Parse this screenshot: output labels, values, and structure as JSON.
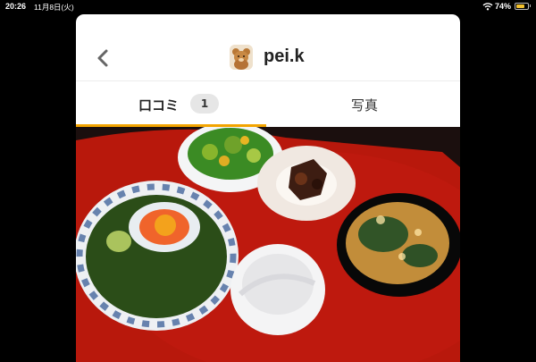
{
  "status_bar": {
    "time": "20:26",
    "date": "11月8日(火)",
    "battery": "74%",
    "battery_level": 0.74,
    "battery_color": "#f2c12e"
  },
  "header": {
    "back_icon": "chevron-left-icon",
    "avatar_icon": "teddy-bear-avatar",
    "username": "pei.k"
  },
  "tabs": [
    {
      "label": "口コミ",
      "count": "1",
      "active": true
    },
    {
      "label": "写真",
      "active": false
    }
  ],
  "colors": {
    "accent": "#f3a400",
    "tray": "#b8180c"
  },
  "photo": {
    "icon": "food-photo"
  }
}
